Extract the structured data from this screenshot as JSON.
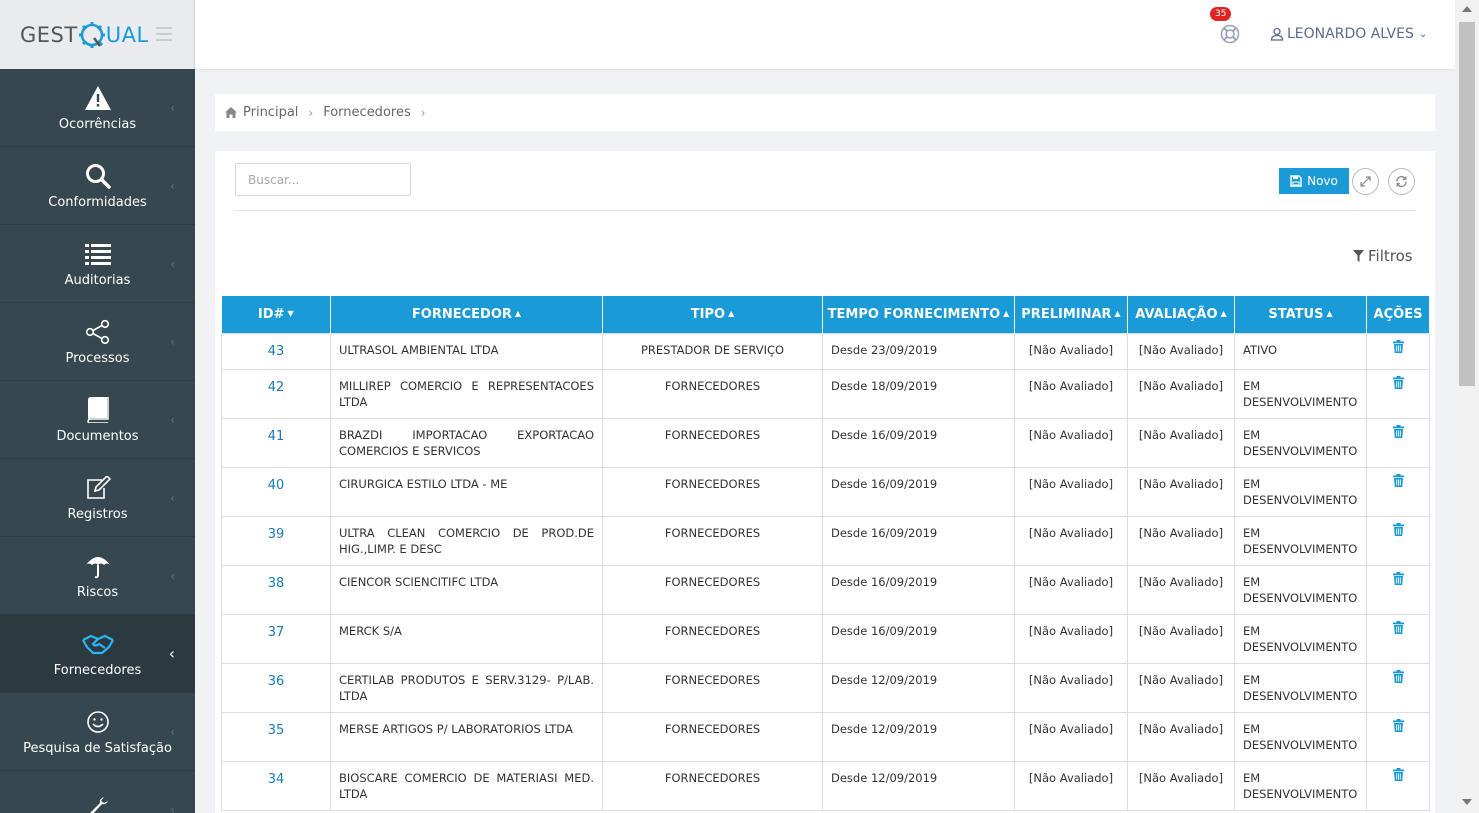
{
  "brand": {
    "part1": "GEST",
    "part2": "UAL"
  },
  "sidebar": {
    "items": [
      {
        "label": "Ocorrências",
        "icon": "warning-icon"
      },
      {
        "label": "Conformidades",
        "icon": "search-icon"
      },
      {
        "label": "Auditorias",
        "icon": "list-icon"
      },
      {
        "label": "Processos",
        "icon": "share-icon"
      },
      {
        "label": "Documentos",
        "icon": "book-icon"
      },
      {
        "label": "Registros",
        "icon": "edit-icon"
      },
      {
        "label": "Riscos",
        "icon": "umbrella-icon"
      },
      {
        "label": "Fornecedores",
        "icon": "handshake-icon",
        "active": true
      },
      {
        "label": "Pesquisa de Satisfação",
        "icon": "smile-icon"
      },
      {
        "label": "",
        "icon": "wrench-icon"
      }
    ]
  },
  "header": {
    "notifications": "35",
    "user": "LEONARDO ALVES"
  },
  "breadcrumb": {
    "home": "Principal",
    "current": "Fornecedores"
  },
  "toolbar": {
    "search_placeholder": "Buscar...",
    "new_label": "Novo",
    "filters_label": "Filtros"
  },
  "table": {
    "headers": {
      "id": "ID#",
      "fornecedor": "FORNECEDOR",
      "tipo": "TIPO",
      "tempo": "TEMPO FORNECIMENTO",
      "preliminar": "PRELIMINAR",
      "avaliacao": "AVALIAÇÃO",
      "status": "STATUS",
      "acoes": "AÇÕES"
    },
    "rows": [
      {
        "id": "43",
        "fornecedor": "ULTRASOL AMBIENTAL LTDA",
        "tipo": "PRESTADOR DE SERVIÇO",
        "tempo": "Desde 23/09/2019",
        "preliminar": "[Não Avaliado]",
        "avaliacao": "[Não Avaliado]",
        "status": "ATIVO"
      },
      {
        "id": "42",
        "fornecedor": "MILLIREP COMERCIO E REPRESENTACOES LTDA",
        "tipo": "FORNECEDORES",
        "tempo": "Desde 18/09/2019",
        "preliminar": "[Não Avaliado]",
        "avaliacao": "[Não Avaliado]",
        "status": "EM DESENVOLVIMENTO"
      },
      {
        "id": "41",
        "fornecedor": "BRAZDI IMPORTACAO EXPORTACAO COMERCIOS E SERVICOS",
        "tipo": "FORNECEDORES",
        "tempo": "Desde 16/09/2019",
        "preliminar": "[Não Avaliado]",
        "avaliacao": "[Não Avaliado]",
        "status": "EM DESENVOLVIMENTO"
      },
      {
        "id": "40",
        "fornecedor": "CIRURGICA ESTILO LTDA - ME",
        "tipo": "FORNECEDORES",
        "tempo": "Desde 16/09/2019",
        "preliminar": "[Não Avaliado]",
        "avaliacao": "[Não Avaliado]",
        "status": "EM DESENVOLVIMENTO"
      },
      {
        "id": "39",
        "fornecedor": "ULTRA CLEAN COMERCIO DE PROD.DE HIG.,LIMP. E DESC",
        "tipo": "FORNECEDORES",
        "tempo": "Desde 16/09/2019",
        "preliminar": "[Não Avaliado]",
        "avaliacao": "[Não Avaliado]",
        "status": "EM DESENVOLVIMENTO"
      },
      {
        "id": "38",
        "fornecedor": "CIENCOR SCIENCITIFC LTDA",
        "tipo": "FORNECEDORES",
        "tempo": "Desde 16/09/2019",
        "preliminar": "[Não Avaliado]",
        "avaliacao": "[Não Avaliado]",
        "status": "EM DESENVOLVIMENTO"
      },
      {
        "id": "37",
        "fornecedor": "MERCK S/A",
        "tipo": "FORNECEDORES",
        "tempo": "Desde 16/09/2019",
        "preliminar": "[Não Avaliado]",
        "avaliacao": "[Não Avaliado]",
        "status": "EM DESENVOLVIMENTO"
      },
      {
        "id": "36",
        "fornecedor": "CERTILAB PRODUTOS E SERV.3129- P/LAB. LTDA",
        "tipo": "FORNECEDORES",
        "tempo": "Desde 12/09/2019",
        "preliminar": "[Não Avaliado]",
        "avaliacao": "[Não Avaliado]",
        "status": "EM DESENVOLVIMENTO"
      },
      {
        "id": "35",
        "fornecedor": "MERSE ARTIGOS P/ LABORATORIOS LTDA",
        "tipo": "FORNECEDORES",
        "tempo": "Desde 12/09/2019",
        "preliminar": "[Não Avaliado]",
        "avaliacao": "[Não Avaliado]",
        "status": "EM DESENVOLVIMENTO"
      },
      {
        "id": "34",
        "fornecedor": "BIOSCARE COMERCIO DE MATERIASI MED. LTDA",
        "tipo": "FORNECEDORES",
        "tempo": "Desde 12/09/2019",
        "preliminar": "[Não Avaliado]",
        "avaliacao": "[Não Avaliado]",
        "status": "EM DESENVOLVIMENTO"
      }
    ]
  },
  "colors": {
    "accent": "#1a9ad6",
    "sidebar": "#37474f",
    "badge": "#e02424"
  }
}
